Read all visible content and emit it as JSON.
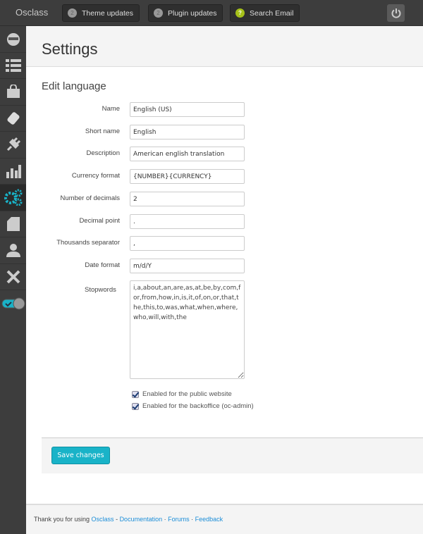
{
  "topbar": {
    "brand": "Osclass",
    "buttons": [
      {
        "badge": "2",
        "label": "Theme updates"
      },
      {
        "badge": "2",
        "label": "Plugin updates"
      },
      {
        "badge": "?",
        "label": "Search Email"
      }
    ]
  },
  "sidebar": {
    "items": [
      "dashboard",
      "listings",
      "market",
      "appearance",
      "plugins",
      "statistics",
      "settings",
      "pages",
      "users",
      "tools",
      "toggle"
    ],
    "active": "settings",
    "accent": "#19b3c8"
  },
  "page": {
    "title": "Settings",
    "section": "Edit language"
  },
  "form": {
    "fields": [
      {
        "label": "Name",
        "value": "English (US)"
      },
      {
        "label": "Short name",
        "value": "English"
      },
      {
        "label": "Description",
        "value": "American english translation"
      },
      {
        "label": "Currency format",
        "value": "{NUMBER}{CURRENCY}"
      },
      {
        "label": "Number of decimals",
        "value": "2"
      },
      {
        "label": "Decimal point",
        "value": "."
      },
      {
        "label": "Thousands separator",
        "value": ","
      },
      {
        "label": "Date format",
        "value": "m/d/Y"
      }
    ],
    "stopwords_label": "Stopwords",
    "stopwords": "i,a,about,an,are,as,at,be,by,com,for,from,how,in,is,it,of,on,or,that,the,this,to,was,what,when,where,who,will,with,the",
    "checkboxes": [
      {
        "label": "Enabled for the public website",
        "checked": true
      },
      {
        "label": "Enabled for the backoffice (oc-admin)",
        "checked": true
      }
    ],
    "save_label": "Save changes"
  },
  "footer": {
    "text": "Thank you for using ",
    "osclass": "Osclass",
    "sep1": " - ",
    "documentation": "Documentation",
    "sep2": " · ",
    "forums": "Forums",
    "sep3": " · ",
    "feedback": "Feedback"
  }
}
